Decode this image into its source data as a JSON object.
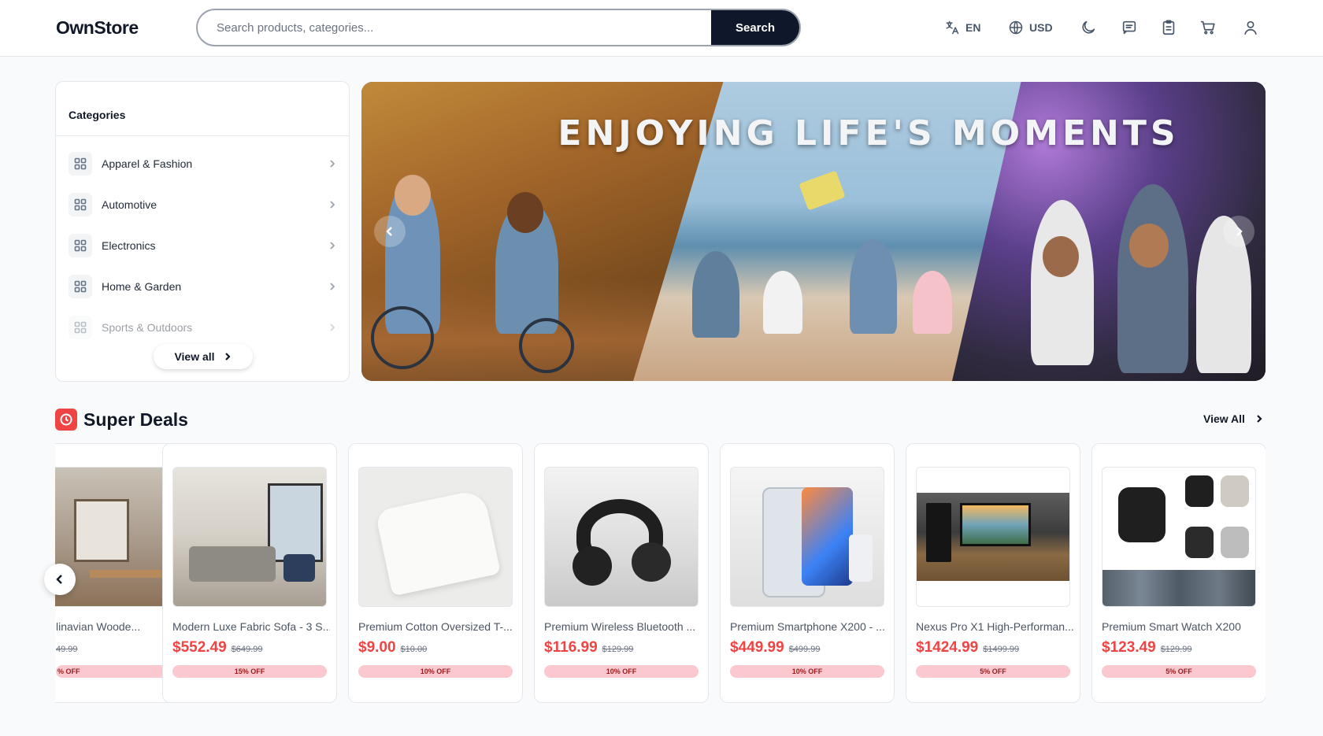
{
  "header": {
    "logo": "OwnStore",
    "search_placeholder": "Search products, categories...",
    "search_button": "Search",
    "language": "EN",
    "currency": "USD",
    "icons": [
      "translate-icon",
      "globe-icon",
      "moon-icon",
      "chat-icon",
      "clipboard-icon",
      "cart-icon",
      "user-icon"
    ]
  },
  "categories": {
    "title": "Categories",
    "items": [
      {
        "label": "Apparel & Fashion"
      },
      {
        "label": "Automotive"
      },
      {
        "label": "Electronics"
      },
      {
        "label": "Home & Garden"
      },
      {
        "label": "Sports & Outdoors"
      }
    ],
    "view_all": "View all"
  },
  "banner": {
    "title": "ENJOYING LIFE'S MOMENTS"
  },
  "deals": {
    "title": "Super Deals",
    "view_all": "View All",
    "accent_color": "#ef4444",
    "items": [
      {
        "name": "linavian Woode...",
        "price": "",
        "old": "49.99",
        "off": "% OFF"
      },
      {
        "name": "Modern Luxe Fabric Sofa - 3 S...",
        "price": "$552.49",
        "old": "$649.99",
        "off": "15% OFF"
      },
      {
        "name": "Premium Cotton Oversized T-...",
        "price": "$9.00",
        "old": "$10.00",
        "off": "10% OFF"
      },
      {
        "name": "Premium Wireless Bluetooth ...",
        "price": "$116.99",
        "old": "$129.99",
        "off": "10% OFF"
      },
      {
        "name": "Premium Smartphone X200 - ...",
        "price": "$449.99",
        "old": "$499.99",
        "off": "10% OFF"
      },
      {
        "name": "Nexus Pro X1 High-Performan...",
        "price": "$1424.99",
        "old": "$1499.99",
        "off": "5% OFF"
      },
      {
        "name": "Premium Smart Watch X200",
        "price": "$123.49",
        "old": "$129.99",
        "off": "5% OFF"
      }
    ]
  }
}
